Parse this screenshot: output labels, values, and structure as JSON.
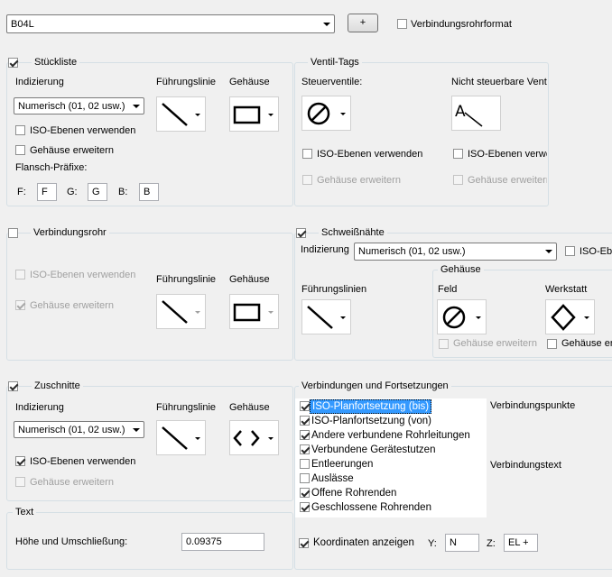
{
  "top": {
    "profile_value": "B04L",
    "add_button": "+",
    "connpipe_format_label": "Verbindungsrohrformat"
  },
  "stueckliste": {
    "title": "Stückliste",
    "indexing_label": "Indizierung",
    "indexing_value": "Numerisch (01, 02 usw.)",
    "leader_label": "Führungslinie",
    "housing_label": "Gehäuse",
    "iso_layers_label": "ISO-Ebenen verwenden",
    "expand_housing_label": "Gehäuse erweitern",
    "flange_prefix_label": "Flansch-Präfixe:",
    "f_label": "F:",
    "f_value": "F",
    "g_label": "G:",
    "g_value": "G",
    "b_label": "B:",
    "b_value": "B"
  },
  "ventil": {
    "title": "Ventil-Tags",
    "control_label": "Steuerventile:",
    "noncontrol_label": "Nicht steuerbare Ventile",
    "iso_layers_label": "ISO-Ebenen verwenden",
    "iso_layers_label2": "ISO-Ebenen verwenden",
    "expand_housing_label": "Gehäuse erweitern",
    "expand_housing_label2": "Gehäuse erweitern"
  },
  "verbindungsrohr": {
    "title": "Verbindungsrohr",
    "iso_layers_label": "ISO-Ebenen verwenden",
    "expand_housing_label": "Gehäuse erweitern",
    "leader_label": "Führungslinie",
    "housing_label": "Gehäuse"
  },
  "schweiss": {
    "title": "Schweißnähte",
    "indexing_label": "Indizierung",
    "indexing_value": "Numerisch (01, 02 usw.)",
    "iso_label": "ISO-Ebenen verwenden",
    "housing_group": "Gehäuse",
    "leaders_label": "Führungslinien",
    "field_label": "Feld",
    "shop_label": "Werkstatt",
    "expand_housing_label": "Gehäuse erweitern",
    "expand_housing_label2": "Gehäuse erweitern"
  },
  "zuschnitte": {
    "title": "Zuschnitte",
    "indexing_label": "Indizierung",
    "indexing_value": "Numerisch (01, 02 usw.)",
    "leader_label": "Führungslinie",
    "housing_label": "Gehäuse",
    "iso_layers_label": "ISO-Ebenen verwenden",
    "expand_housing_label": "Gehäuse erweitern"
  },
  "text": {
    "title": "Text",
    "height_label": "Höhe und Umschließung:",
    "height_value": "0.09375"
  },
  "verbindungen": {
    "title": "Verbindungen und Fortsetzungen",
    "items": [
      {
        "label": "ISO-Planfortsetzung (bis)",
        "checked": true
      },
      {
        "label": "ISO-Planfortsetzung (von)",
        "checked": true
      },
      {
        "label": "Andere verbundene Rohrleitungen",
        "checked": true
      },
      {
        "label": "Verbundene Gerätestutzen",
        "checked": true
      },
      {
        "label": "Entleerungen",
        "checked": false
      },
      {
        "label": "Auslässe",
        "checked": false
      },
      {
        "label": "Offene Rohrenden",
        "checked": true
      },
      {
        "label": "Geschlossene Rohrenden",
        "checked": true
      }
    ],
    "right_label1": "Verbindungspunkte",
    "right_label2": "Verbindungstext",
    "coords_label": "Koordinaten anzeigen",
    "y_label": "Y:",
    "y_value": "N",
    "z_label": "Z:",
    "z_value": "EL +"
  }
}
